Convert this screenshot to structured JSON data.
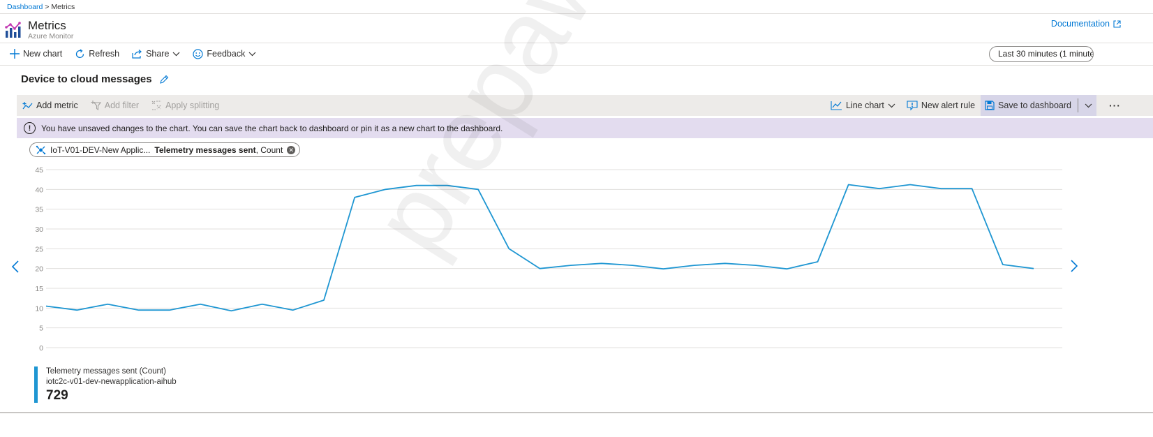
{
  "breadcrumb": {
    "root": "Dashboard",
    "separator": ">",
    "current": "Metrics"
  },
  "header": {
    "title": "Metrics",
    "subtitle": "Azure Monitor",
    "doc_link": "Documentation"
  },
  "commands": {
    "new_chart": "New chart",
    "refresh": "Refresh",
    "share": "Share",
    "feedback": "Feedback",
    "time_range": "Last 30 minutes (1 minute)"
  },
  "chart_title": "Device to cloud messages",
  "toolbar": {
    "add_metric": "Add metric",
    "add_filter": "Add filter",
    "apply_splitting": "Apply splitting",
    "chart_type": "Line chart",
    "new_alert_rule": "New alert rule",
    "save_to_dashboard": "Save to dashboard",
    "more": "···"
  },
  "banner": {
    "icon": "!",
    "text": "You have unsaved changes to the chart. You can save the chart back to dashboard or pin it as a new chart to the dashboard."
  },
  "metric_pill": {
    "resource": "IoT-V01-DEV-New Applic...",
    "metric": "Telemetry messages sent",
    "aggregation": ", Count"
  },
  "legend": {
    "name": "Telemetry messages sent (Count)",
    "resource": "iotc2c-v01-dev-newapplication-aihub",
    "value": "729"
  },
  "watermark": "prepaway",
  "colors": {
    "accent": "#0078d4",
    "series": "#1e96d2",
    "banner_bg": "#e3dcef",
    "toolbar_bg": "#edebe9"
  },
  "chart_data": {
    "type": "line",
    "ylim": [
      0,
      45
    ],
    "yticks": [
      "0",
      "5",
      "10",
      "15",
      "20",
      "25",
      "30",
      "35",
      "40",
      "45"
    ],
    "grid": true,
    "series": [
      {
        "values": [
          10.5,
          9.5,
          11,
          9.5,
          9.5,
          11,
          9.3,
          11,
          9.5,
          12,
          38,
          40,
          41,
          41,
          40,
          25,
          20,
          20.8,
          21.3,
          20.8,
          19.9,
          20.8,
          21.3,
          20.8,
          19.9,
          21.7,
          41.2,
          40.2,
          41.2,
          40.2,
          40.2,
          21,
          20
        ]
      }
    ]
  }
}
